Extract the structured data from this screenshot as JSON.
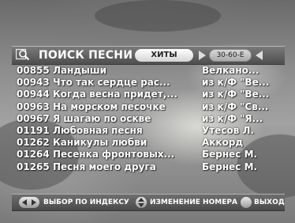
{
  "header": {
    "title": "ПОИСК ПЕСНИ",
    "category_label": "ХИТЫ",
    "range_label": "30-60-Е",
    "icon": "magnifier-search-icon"
  },
  "songs": [
    {
      "number": "00855",
      "title": "Ландыши",
      "artist": "Велкано..."
    },
    {
      "number": "00943",
      "title": "Что так сердце рас...",
      "artist": "из к/Ф \"Ве..."
    },
    {
      "number": "00944",
      "title": "Когда весна придет,...",
      "artist": "из к/Ф \"Ве..."
    },
    {
      "number": "00963",
      "title": "На морском песочке",
      "artist": "из к/Ф \"Св..."
    },
    {
      "number": "00967",
      "title": "Я шагаю по оскве",
      "artist": "из к/Ф \"Я..."
    },
    {
      "number": "01191",
      "title": "Любовная песня",
      "artist": "Утесов Л."
    },
    {
      "number": "01262",
      "title": "Каникулы любви",
      "artist": "Аккорд"
    },
    {
      "number": "01264",
      "title": "Песенка фронтовых...",
      "artist": "Бернес М."
    },
    {
      "number": "01265",
      "title": "Песня моего друга",
      "artist": "Бернес М."
    }
  ],
  "footer": {
    "index_label": "ВЫБОР ПО ИНДЕКСУ",
    "change_label": "ИЗМЕНЕНИЕ НОМЕРА",
    "exit_label": "ВЫХОД"
  },
  "colors": {
    "bar": "#5a5a5a",
    "text": "#ffffff",
    "pill": "#ffffff"
  }
}
